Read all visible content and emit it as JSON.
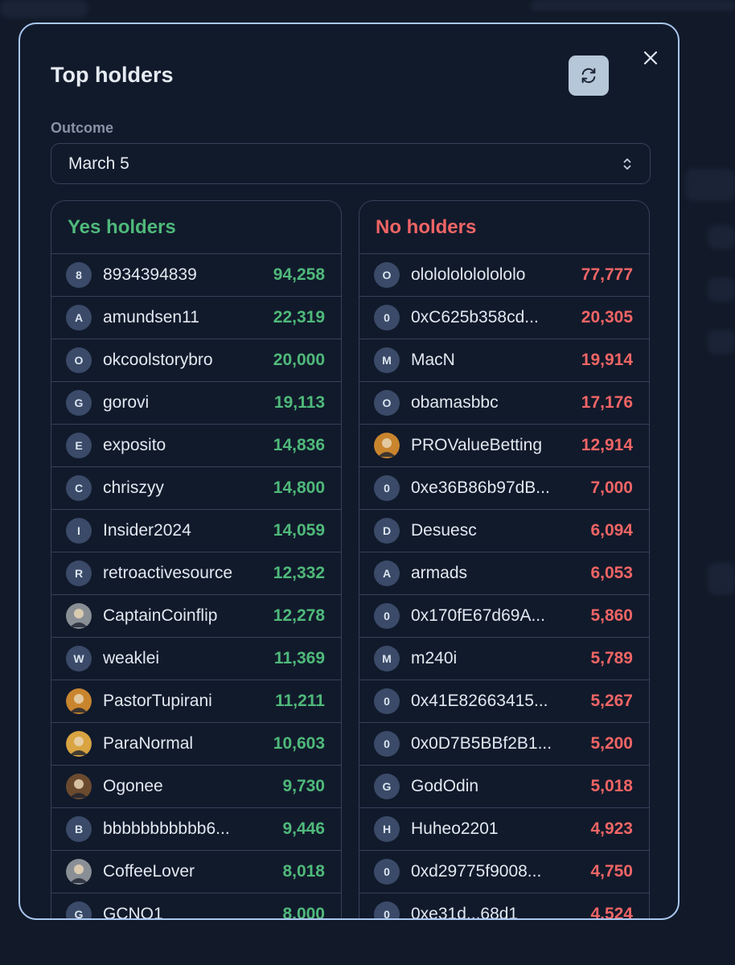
{
  "modal": {
    "title": "Top holders",
    "outcome_label": "Outcome",
    "outcome_value": "March 5"
  },
  "icons": {
    "refresh": "refresh-icon",
    "close": "close-icon",
    "select_chevron": "chevron-up-down-icon"
  },
  "colors": {
    "yes": "#4fb97a",
    "no": "#f06565",
    "border_accent": "#a9c7f0",
    "background": "#111a2b"
  },
  "yes_holders": {
    "title": "Yes holders",
    "rows": [
      {
        "avatar": "8",
        "name": "8934394839",
        "value": "94,258"
      },
      {
        "avatar": "A",
        "name": "amundsen11",
        "value": "22,319"
      },
      {
        "avatar": "O",
        "name": "okcoolstorybro",
        "value": "20,000"
      },
      {
        "avatar": "G",
        "name": "gorovi",
        "value": "19,113"
      },
      {
        "avatar": "E",
        "name": "exposito",
        "value": "14,836"
      },
      {
        "avatar": "C",
        "name": "chriszyy",
        "value": "14,800"
      },
      {
        "avatar": "I",
        "name": "Insider2024",
        "value": "14,059"
      },
      {
        "avatar": "R",
        "name": "retroactivesource",
        "value": "12,332"
      },
      {
        "avatar": "",
        "name": "CaptainCoinflip",
        "value": "12,278"
      },
      {
        "avatar": "W",
        "name": "weaklei",
        "value": "11,369"
      },
      {
        "avatar": "",
        "name": "PastorTupirani",
        "value": "11,211"
      },
      {
        "avatar": "",
        "name": "ParaNormal",
        "value": "10,603"
      },
      {
        "avatar": "",
        "name": "Ogonee",
        "value": "9,730"
      },
      {
        "avatar": "B",
        "name": "bbbbbbbbbbb6...",
        "value": "9,446"
      },
      {
        "avatar": "",
        "name": "CoffeeLover",
        "value": "8,018"
      },
      {
        "avatar": "G",
        "name": "GCNO1",
        "value": "8,000"
      }
    ]
  },
  "no_holders": {
    "title": "No holders",
    "rows": [
      {
        "avatar": "O",
        "name": "ololololololololo",
        "value": "77,777"
      },
      {
        "avatar": "0",
        "name": "0xC625b358cd...",
        "value": "20,305"
      },
      {
        "avatar": "M",
        "name": "MacN",
        "value": "19,914"
      },
      {
        "avatar": "O",
        "name": "obamasbbc",
        "value": "17,176"
      },
      {
        "avatar": "",
        "name": "PROValueBetting",
        "value": "12,914"
      },
      {
        "avatar": "0",
        "name": "0xe36B86b97dB...",
        "value": "7,000"
      },
      {
        "avatar": "D",
        "name": "Desuesc",
        "value": "6,094"
      },
      {
        "avatar": "A",
        "name": "armads",
        "value": "6,053"
      },
      {
        "avatar": "0",
        "name": "0x170fE67d69A...",
        "value": "5,860"
      },
      {
        "avatar": "M",
        "name": "m240i",
        "value": "5,789"
      },
      {
        "avatar": "0",
        "name": "0x41E82663415...",
        "value": "5,267"
      },
      {
        "avatar": "0",
        "name": "0x0D7B5BBf2B1...",
        "value": "5,200"
      },
      {
        "avatar": "G",
        "name": "GodOdin",
        "value": "5,018"
      },
      {
        "avatar": "H",
        "name": "Huheo2201",
        "value": "4,923"
      },
      {
        "avatar": "0",
        "name": "0xd29775f9008...",
        "value": "4,750"
      },
      {
        "avatar": "0",
        "name": "0xe31d...68d1",
        "value": "4,524"
      }
    ]
  }
}
